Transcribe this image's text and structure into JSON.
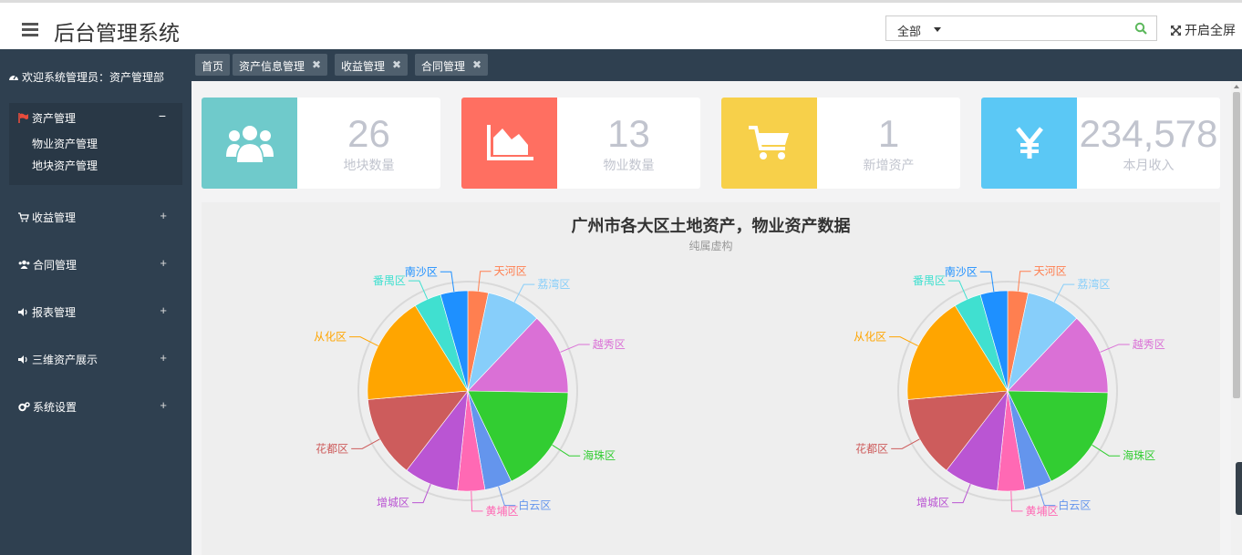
{
  "header": {
    "title": "后台管理系统",
    "scope_select": "全部",
    "search_placeholder": "",
    "fullscreen_label": "开启全屏"
  },
  "sidebar": {
    "welcome": "欢迎系统管理员：资产管理部",
    "open_menu": {
      "label": "资产管理",
      "toggle": "−",
      "items": [
        "物业资产管理",
        "地块资产管理"
      ]
    },
    "items": [
      {
        "label": "收益管理",
        "icon": "cart-icon"
      },
      {
        "label": "合同管理",
        "icon": "users-icon"
      },
      {
        "label": "报表管理",
        "icon": "volume-icon"
      },
      {
        "label": "三维资产展示",
        "icon": "volume-icon"
      },
      {
        "label": "系统设置",
        "icon": "gears-icon"
      }
    ],
    "expand_symbol": "+"
  },
  "tabs": [
    {
      "label": "首页",
      "closable": false
    },
    {
      "label": "资产信息管理",
      "closable": true
    },
    {
      "label": "收益管理",
      "closable": true
    },
    {
      "label": "合同管理",
      "closable": true
    }
  ],
  "stats": [
    {
      "value": "26",
      "label": "地块数量",
      "color": "#6fcacb",
      "icon": "users-icon"
    },
    {
      "value": "13",
      "label": "物业数量",
      "color": "#ff6f61",
      "icon": "area-chart-icon"
    },
    {
      "value": "1",
      "label": "新增资产",
      "color": "#f7d04a",
      "icon": "cart-icon"
    },
    {
      "value": "234,578",
      "label": "本月收入",
      "color": "#5bc8f5",
      "icon": "yen-icon"
    }
  ],
  "chart_data": [
    {
      "type": "pie",
      "title": "广州市各大区土地资产，物业资产数据",
      "subtitle": "纯属虚构",
      "categories": [
        "天河区",
        "荔湾区",
        "越秀区",
        "海珠区",
        "白云区",
        "黄埔区",
        "增城区",
        "花都区",
        "从化区",
        "番禺区",
        "南沙区"
      ],
      "values": [
        3,
        8,
        12,
        16,
        4,
        4,
        8,
        12,
        16,
        4,
        4
      ],
      "colors": [
        "#ff7f50",
        "#87cefa",
        "#da70d6",
        "#32cd32",
        "#6495ed",
        "#ff69b4",
        "#ba55d3",
        "#cd5c5c",
        "#ffa500",
        "#40e0d0",
        "#1e90ff"
      ]
    },
    {
      "type": "pie",
      "categories": [
        "天河区",
        "荔湾区",
        "越秀区",
        "海珠区",
        "白云区",
        "黄埔区",
        "增城区",
        "花都区",
        "从化区",
        "番禺区",
        "南沙区"
      ],
      "values": [
        3,
        8,
        12,
        16,
        4,
        4,
        8,
        12,
        16,
        4,
        4
      ],
      "colors": [
        "#ff7f50",
        "#87cefa",
        "#da70d6",
        "#32cd32",
        "#6495ed",
        "#ff69b4",
        "#ba55d3",
        "#cd5c5c",
        "#ffa500",
        "#40e0d0",
        "#1e90ff"
      ]
    }
  ]
}
